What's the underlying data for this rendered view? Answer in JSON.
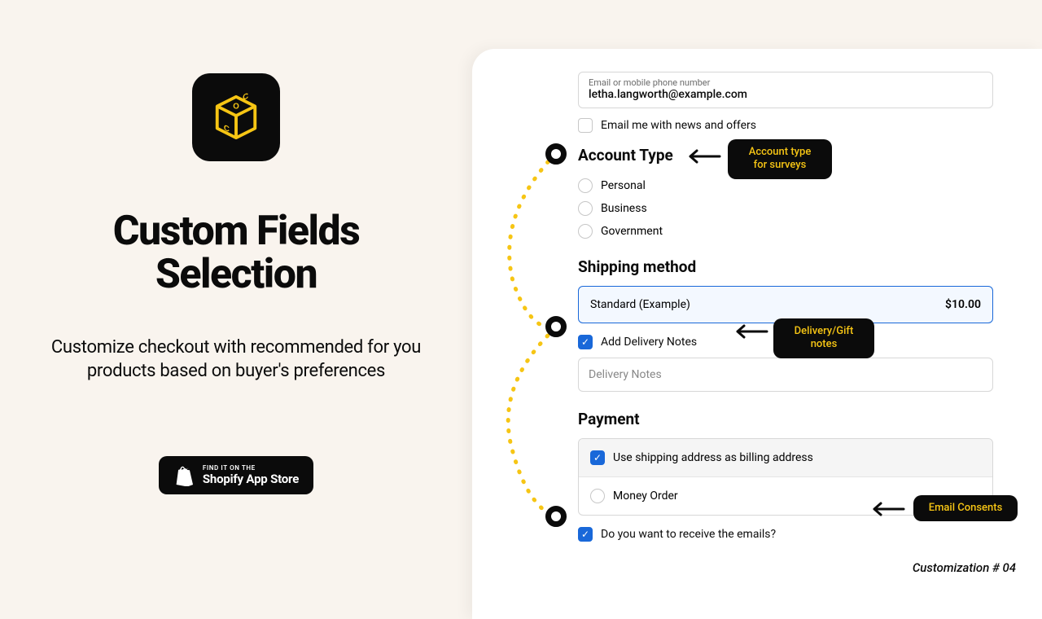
{
  "left": {
    "title": "Custom Fields Selection",
    "subtitle": "Customize checkout with recommended for you products based on buyer's preferences",
    "badge_top": "FIND IT ON THE",
    "badge_bottom": "Shopify App Store"
  },
  "checkout": {
    "email_label": "Email or mobile phone number",
    "email_value": "letha.langworth@example.com",
    "news_label": "Email me with news and offers",
    "account_type_heading": "Account Type",
    "account_options": {
      "a": "Personal",
      "b": "Business",
      "c": "Government"
    },
    "shipping_heading": "Shipping method",
    "shipping_name": "Standard (Example)",
    "shipping_price": "$10.00",
    "add_notes_label": "Add Delivery Notes",
    "notes_placeholder": "Delivery Notes",
    "payment_heading": "Payment",
    "billing_same_label": "Use shipping address as billing address",
    "money_order_label": "Money Order",
    "emails_consent_label": "Do you want to receive the emails?"
  },
  "callouts": {
    "account": "Account type for surveys",
    "delivery": "Delivery/Gift notes",
    "consent": "Email Consents"
  },
  "footer": "Customization # 04"
}
